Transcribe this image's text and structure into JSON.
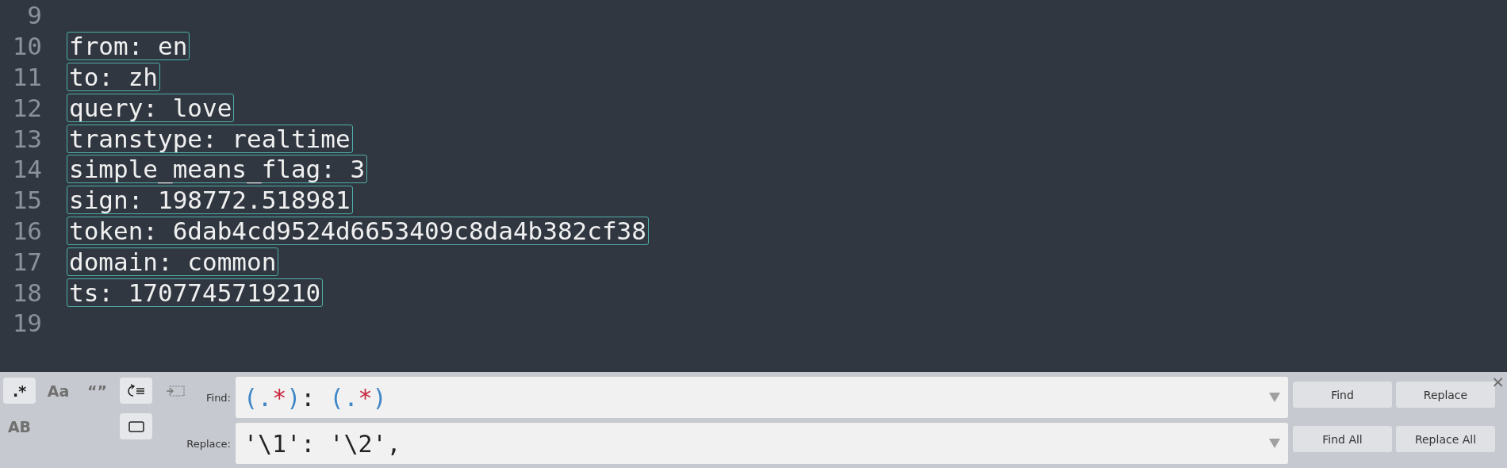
{
  "editor": {
    "lines": [
      {
        "number": "9"
      },
      {
        "number": "10",
        "text": "from: en",
        "highlighted": true
      },
      {
        "number": "11",
        "text": "to: zh",
        "highlighted": true
      },
      {
        "number": "12",
        "text": "query: love",
        "highlighted": true
      },
      {
        "number": "13",
        "text": "transtype: realtime",
        "highlighted": true
      },
      {
        "number": "14",
        "text": "simple_means_flag: 3",
        "highlighted": true
      },
      {
        "number": "15",
        "text": "sign: 198772.518981",
        "highlighted": true
      },
      {
        "number": "16",
        "text": "token: 6dab4cd9524d6653409c8da4b382cf38",
        "highlighted": true
      },
      {
        "number": "17",
        "text": "domain: common",
        "highlighted": true
      },
      {
        "number": "18",
        "text": "ts: 1707745719210",
        "highlighted": true
      },
      {
        "number": "19"
      }
    ]
  },
  "find_panel": {
    "options": [
      {
        "kind": "text",
        "label": ".*",
        "selected": true
      },
      {
        "kind": "text",
        "label": "Aa",
        "selected": false
      },
      {
        "kind": "text",
        "label": "“”",
        "selected": false
      },
      {
        "kind": "wrap",
        "selected": true
      },
      {
        "kind": "in-selection",
        "selected": false
      },
      {
        "kind": "text",
        "label": "AB",
        "selected": false
      },
      {
        "kind": "none"
      },
      {
        "kind": "none"
      },
      {
        "kind": "highlight",
        "selected": true
      }
    ],
    "find": {
      "label": "Find:",
      "tokens": [
        {
          "kind": "paren",
          "text": "("
        },
        {
          "kind": "dot",
          "text": "."
        },
        {
          "kind": "star",
          "text": "*"
        },
        {
          "kind": "paren",
          "text": ")"
        },
        {
          "kind": "plain",
          "text": ": "
        },
        {
          "kind": "paren",
          "text": "("
        },
        {
          "kind": "dot",
          "text": "."
        },
        {
          "kind": "star",
          "text": "*"
        },
        {
          "kind": "paren",
          "text": ")"
        }
      ]
    },
    "replace": {
      "label": "Replace:",
      "value": "'\\1': '\\2',"
    },
    "buttons": [
      "Find",
      "Replace",
      "Find All",
      "Replace All"
    ],
    "close": "×"
  }
}
